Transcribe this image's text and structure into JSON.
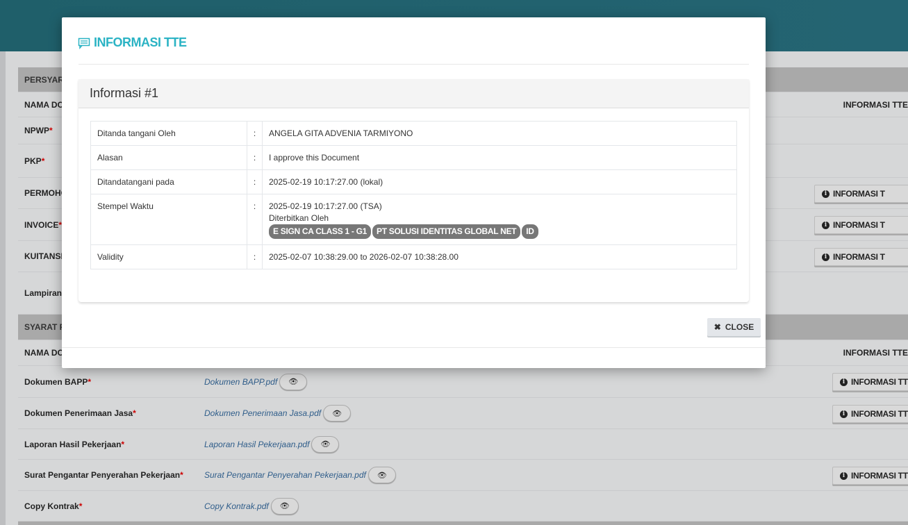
{
  "background": {
    "section1": "PERSYARA",
    "col_name": "NAMA DO",
    "col_info": "INFORMASI TTE",
    "rows1": [
      {
        "label": "NPWP",
        "required": true
      },
      {
        "label": "PKP",
        "required": true
      },
      {
        "label": "PERMOHO",
        "required": false,
        "button": "INFORMASI T"
      },
      {
        "label": "INVOICE",
        "required": true,
        "button": "INFORMASI T"
      },
      {
        "label": "KUITANSI",
        "required": false,
        "button": "INFORMASI T"
      },
      {
        "label": "Lampiran",
        "required": false
      }
    ],
    "section2": "SYARAT P",
    "rows2": [
      {
        "label": "Dokumen BAPP",
        "file": "Dokumen BAPP.pdf",
        "button": "INFORMASI TT"
      },
      {
        "label": "Dokumen Penerimaan Jasa",
        "file": "Dokumen Penerimaan Jasa.pdf",
        "button": "INFORMASI TT"
      },
      {
        "label": "Laporan Hasil Pekerjaan",
        "file": "Laporan Hasil Pekerjaan.pdf"
      },
      {
        "label": "Surat Pengantar Penyerahan Pekerjaan",
        "file": "Surat Pengantar Penyerahan Pekerjaan.pdf",
        "button": "INFORMASI TT"
      },
      {
        "label": "Copy Kontrak",
        "file": "Copy Kontrak.pdf"
      }
    ],
    "required_mark": "*"
  },
  "modal": {
    "title": "INFORMASI TTE",
    "panel_title": "Informasi #1",
    "sep": ":",
    "fields": {
      "signer_label": "Ditanda tangani Oleh",
      "signer": "ANGELA GITA ADVENIA TARMIYONO",
      "reason_label": "Alasan",
      "reason": "I approve this Document",
      "signed_label": "Ditandatangani pada",
      "signed": "2025-02-19 10:17:27.00 (lokal)",
      "ts_label": "Stempel Waktu",
      "ts": "2025-02-19 10:17:27.00 (TSA)",
      "issued_by": "Diterbitkan Oleh",
      "badges": [
        "E SIGN CA CLASS 1 - G1",
        "PT SOLUSI IDENTITAS GLOBAL NET",
        "ID"
      ],
      "validity_label": "Validity",
      "validity": "2025-02-07 10:38:29.00 to 2026-02-07 10:38:28.00"
    },
    "close": "CLOSE"
  },
  "colors": {
    "accent": "#2bb3c4",
    "topbar": "#236472"
  }
}
